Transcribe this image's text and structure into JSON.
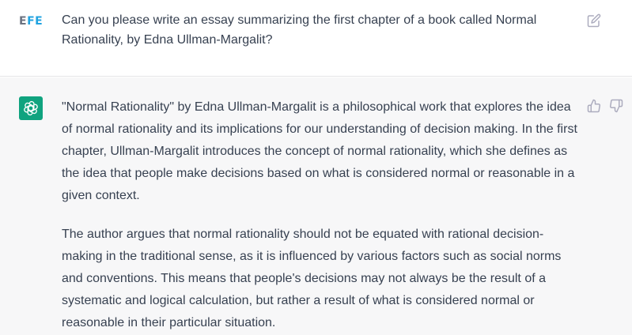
{
  "user_message": {
    "avatar_initials_part1": "E",
    "avatar_initials_part2": "FE",
    "text": "Can you please write an essay summarizing the first chapter of a book called Normal Rationality, by Edna Ullman-Margalit?"
  },
  "assistant_message": {
    "paragraphs": [
      "\"Normal Rationality\" by Edna Ullman-Margalit is a philosophical work that explores the idea of normal rationality and its implications for our understanding of decision making. In the first chapter, Ullman-Margalit introduces the concept of normal rationality, which she defines as the idea that people make decisions based on what is considered normal or reasonable in a given context.",
      "The author argues that normal rationality should not be equated with rational decision-making in the traditional sense, as it is influenced by various factors such as social norms and conventions. This means that people's decisions may not always be the result of a systematic and logical calculation, but rather a result of what is considered normal or reasonable in their particular situation."
    ]
  },
  "icons": {
    "edit": "edit-icon",
    "assistant_logo": "openai-logo-icon",
    "thumbs_up": "thumbs-up-icon",
    "thumbs_down": "thumbs-down-icon"
  },
  "colors": {
    "assistant_accent": "#10a37f",
    "assistant_row_bg": "#f7f7f8",
    "avatar_blue": "#21a3e0"
  }
}
